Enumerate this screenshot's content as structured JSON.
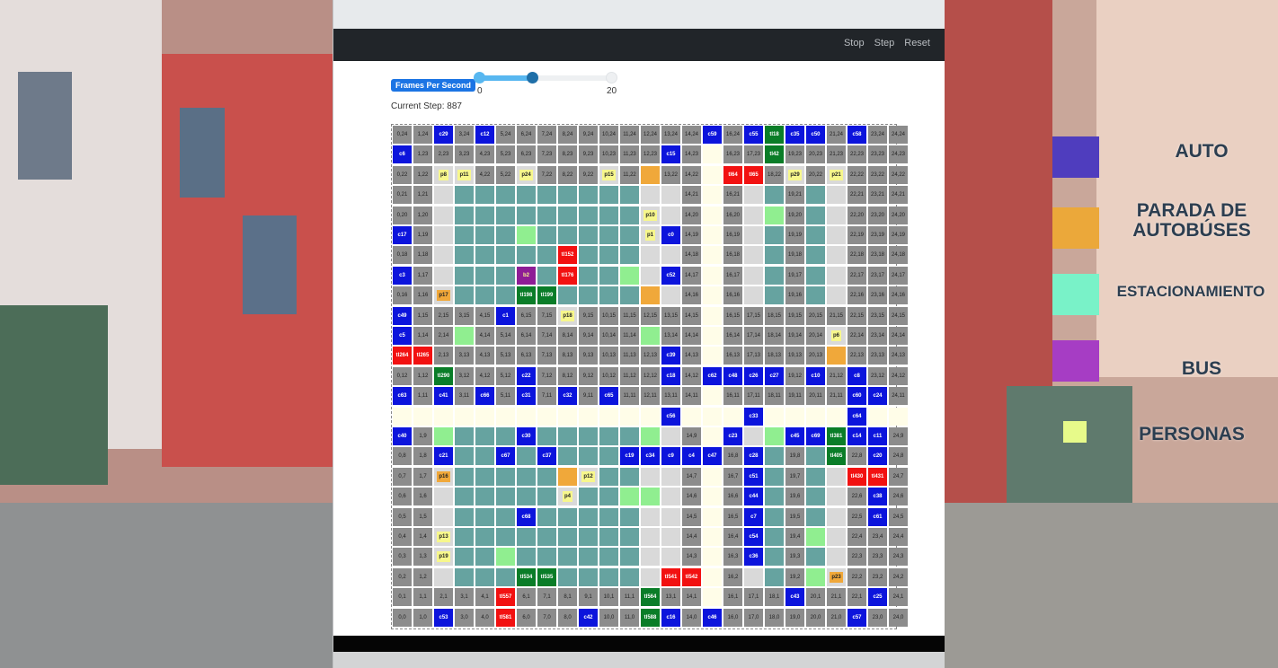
{
  "navbar": {
    "links": [
      "Stop",
      "Step",
      "Reset"
    ]
  },
  "controls": {
    "fps_label": "Frames Per Second",
    "slider": {
      "min": "0",
      "max": "20",
      "value": 8,
      "max_value": 20
    },
    "current_step": "Current Step: 887"
  },
  "colors": {
    "road": "#8c8c8c",
    "parking": "#66a3a0",
    "building": "#d9d9d9",
    "sidewalk": "#fffde8",
    "car": "#0c14dc",
    "light_red": "#f21111",
    "light_green": "#0a7d28",
    "bus_stop": "#f0a83a",
    "person": "#f7f78c",
    "bus": "#8e1d96",
    "grass": "#90ee90"
  },
  "grid": {
    "size": 25,
    "vertical_roads": [
      0,
      1,
      3,
      4,
      5,
      6,
      7,
      8,
      9,
      10,
      11,
      12,
      13,
      14,
      16,
      17,
      19,
      20,
      21,
      22,
      23
    ],
    "horizontal_roads": [
      0,
      1,
      10,
      11,
      12,
      13,
      14,
      15,
      22,
      23,
      24
    ],
    "sidewalk_cols": [
      15
    ],
    "sidewalk_rows": [
      10
    ],
    "block_cols": [
      [
        2,
        13
      ],
      [
        17,
        18
      ],
      [
        20,
        21
      ]
    ],
    "block_rows": [
      [
        2,
        9
      ],
      [
        16,
        21
      ]
    ],
    "grass_cells": [
      [
        6,
        19
      ],
      [
        3,
        14
      ],
      [
        12,
        14
      ],
      [
        12,
        9
      ],
      [
        2,
        9
      ],
      [
        12,
        6
      ],
      [
        18,
        20
      ],
      [
        18,
        9
      ],
      [
        11,
        6
      ],
      [
        21,
        14
      ],
      [
        20,
        4
      ],
      [
        20,
        2
      ],
      [
        5,
        3
      ],
      [
        11,
        17
      ]
    ],
    "tokens": [
      {
        "c": 2,
        "r": 24,
        "t": "c29",
        "k": "car"
      },
      {
        "c": 4,
        "r": 24,
        "t": "c12",
        "k": "car"
      },
      {
        "c": 15,
        "r": 24,
        "t": "c59",
        "k": "car"
      },
      {
        "c": 17,
        "r": 24,
        "t": "c55",
        "k": "car"
      },
      {
        "c": 18,
        "r": 24,
        "t": "tl18",
        "k": "light_green"
      },
      {
        "c": 19,
        "r": 24,
        "t": "c35",
        "k": "car"
      },
      {
        "c": 20,
        "r": 24,
        "t": "c50",
        "k": "car"
      },
      {
        "c": 22,
        "r": 24,
        "t": "c58",
        "k": "car"
      },
      {
        "c": 0,
        "r": 23,
        "t": "c6",
        "k": "car"
      },
      {
        "c": 13,
        "r": 23,
        "t": "c15",
        "k": "car"
      },
      {
        "c": 18,
        "r": 23,
        "t": "tl42",
        "k": "light_green"
      },
      {
        "c": 2,
        "r": 22,
        "t": "p8",
        "k": "person"
      },
      {
        "c": 3,
        "r": 22,
        "t": "p11",
        "k": "person"
      },
      {
        "c": 6,
        "r": 22,
        "t": "p24",
        "k": "person"
      },
      {
        "c": 10,
        "r": 22,
        "t": "p15",
        "k": "person"
      },
      {
        "c": 12,
        "r": 22,
        "t": "",
        "k": "bus_stop"
      },
      {
        "c": 16,
        "r": 22,
        "t": "tl64",
        "k": "light_red"
      },
      {
        "c": 17,
        "r": 22,
        "t": "tl65",
        "k": "light_red"
      },
      {
        "c": 19,
        "r": 22,
        "t": "p29",
        "k": "person"
      },
      {
        "c": 21,
        "r": 22,
        "t": "p21",
        "k": "person"
      },
      {
        "c": 12,
        "r": 20,
        "t": "p10",
        "k": "person"
      },
      {
        "c": 0,
        "r": 19,
        "t": "c17",
        "k": "car"
      },
      {
        "c": 12,
        "r": 19,
        "t": "p1",
        "k": "person"
      },
      {
        "c": 13,
        "r": 19,
        "t": "c0",
        "k": "car"
      },
      {
        "c": 8,
        "r": 18,
        "t": "tl152",
        "k": "light_red"
      },
      {
        "c": 0,
        "r": 17,
        "t": "c3",
        "k": "car"
      },
      {
        "c": 6,
        "r": 17,
        "t": "b2",
        "k": "bus"
      },
      {
        "c": 8,
        "r": 17,
        "t": "tl176",
        "k": "light_red"
      },
      {
        "c": 13,
        "r": 17,
        "t": "c52",
        "k": "car"
      },
      {
        "c": 2,
        "r": 16,
        "t": "p17",
        "k": "bus_stop"
      },
      {
        "c": 6,
        "r": 16,
        "t": "tl198",
        "k": "light_green"
      },
      {
        "c": 7,
        "r": 16,
        "t": "tl199",
        "k": "light_green"
      },
      {
        "c": 12,
        "r": 16,
        "t": "",
        "k": "bus_stop"
      },
      {
        "c": 0,
        "r": 15,
        "t": "c49",
        "k": "car"
      },
      {
        "c": 5,
        "r": 15,
        "t": "c1",
        "k": "car"
      },
      {
        "c": 8,
        "r": 15,
        "t": "p18",
        "k": "person"
      },
      {
        "c": 0,
        "r": 14,
        "t": "c5",
        "k": "car"
      },
      {
        "c": 21,
        "r": 14,
        "t": "p6",
        "k": "person"
      },
      {
        "c": 0,
        "r": 13,
        "t": "tl264",
        "k": "light_red"
      },
      {
        "c": 1,
        "r": 13,
        "t": "tl265",
        "k": "light_red"
      },
      {
        "c": 13,
        "r": 13,
        "t": "c39",
        "k": "car"
      },
      {
        "c": 21,
        "r": 13,
        "t": "",
        "k": "bus_stop"
      },
      {
        "c": 2,
        "r": 12,
        "t": "tl290",
        "k": "light_green"
      },
      {
        "c": 6,
        "r": 12,
        "t": "c22",
        "k": "car"
      },
      {
        "c": 13,
        "r": 12,
        "t": "c18",
        "k": "car"
      },
      {
        "c": 15,
        "r": 12,
        "t": "c62",
        "k": "car"
      },
      {
        "c": 16,
        "r": 12,
        "t": "c48",
        "k": "car"
      },
      {
        "c": 17,
        "r": 12,
        "t": "c26",
        "k": "car"
      },
      {
        "c": 18,
        "r": 12,
        "t": "c27",
        "k": "car"
      },
      {
        "c": 20,
        "r": 12,
        "t": "c10",
        "k": "car"
      },
      {
        "c": 22,
        "r": 12,
        "t": "c8",
        "k": "car"
      },
      {
        "c": 0,
        "r": 11,
        "t": "c63",
        "k": "car"
      },
      {
        "c": 2,
        "r": 11,
        "t": "c41",
        "k": "car"
      },
      {
        "c": 4,
        "r": 11,
        "t": "c66",
        "k": "car"
      },
      {
        "c": 6,
        "r": 11,
        "t": "c31",
        "k": "car"
      },
      {
        "c": 8,
        "r": 11,
        "t": "c32",
        "k": "car"
      },
      {
        "c": 10,
        "r": 11,
        "t": "c65",
        "k": "car"
      },
      {
        "c": 22,
        "r": 11,
        "t": "c60",
        "k": "car"
      },
      {
        "c": 23,
        "r": 11,
        "t": "c24",
        "k": "car"
      },
      {
        "c": 13,
        "r": 10,
        "t": "c56",
        "k": "car"
      },
      {
        "c": 17,
        "r": 10,
        "t": "c33",
        "k": "car"
      },
      {
        "c": 22,
        "r": 10,
        "t": "c64",
        "k": "car"
      },
      {
        "c": 0,
        "r": 9,
        "t": "c40",
        "k": "car"
      },
      {
        "c": 6,
        "r": 9,
        "t": "c30",
        "k": "car"
      },
      {
        "c": 16,
        "r": 9,
        "t": "c23",
        "k": "car"
      },
      {
        "c": 19,
        "r": 9,
        "t": "c45",
        "k": "car"
      },
      {
        "c": 20,
        "r": 9,
        "t": "c69",
        "k": "car"
      },
      {
        "c": 21,
        "r": 9,
        "t": "tl381",
        "k": "light_green"
      },
      {
        "c": 22,
        "r": 9,
        "t": "c14",
        "k": "car"
      },
      {
        "c": 23,
        "r": 9,
        "t": "c11",
        "k": "car"
      },
      {
        "c": 2,
        "r": 8,
        "t": "c21",
        "k": "car"
      },
      {
        "c": 5,
        "r": 8,
        "t": "c67",
        "k": "car"
      },
      {
        "c": 7,
        "r": 8,
        "t": "c37",
        "k": "car"
      },
      {
        "c": 11,
        "r": 8,
        "t": "c19",
        "k": "car"
      },
      {
        "c": 12,
        "r": 8,
        "t": "c34",
        "k": "car"
      },
      {
        "c": 13,
        "r": 8,
        "t": "c9",
        "k": "car"
      },
      {
        "c": 14,
        "r": 8,
        "t": "c4",
        "k": "car"
      },
      {
        "c": 15,
        "r": 8,
        "t": "c47",
        "k": "car"
      },
      {
        "c": 17,
        "r": 8,
        "t": "c28",
        "k": "car"
      },
      {
        "c": 21,
        "r": 8,
        "t": "tl405",
        "k": "light_green"
      },
      {
        "c": 23,
        "r": 8,
        "t": "c20",
        "k": "car"
      },
      {
        "c": 2,
        "r": 7,
        "t": "p16",
        "k": "bus_stop"
      },
      {
        "c": 8,
        "r": 7,
        "t": "",
        "k": "bus_stop"
      },
      {
        "c": 9,
        "r": 7,
        "t": "p12",
        "k": "person"
      },
      {
        "c": 17,
        "r": 7,
        "t": "c51",
        "k": "car"
      },
      {
        "c": 22,
        "r": 7,
        "t": "tl430",
        "k": "light_red"
      },
      {
        "c": 23,
        "r": 7,
        "t": "tl431",
        "k": "light_red"
      },
      {
        "c": 8,
        "r": 6,
        "t": "p4",
        "k": "person"
      },
      {
        "c": 17,
        "r": 6,
        "t": "c44",
        "k": "car"
      },
      {
        "c": 23,
        "r": 6,
        "t": "c38",
        "k": "car"
      },
      {
        "c": 6,
        "r": 5,
        "t": "c68",
        "k": "car"
      },
      {
        "c": 17,
        "r": 5,
        "t": "c7",
        "k": "car"
      },
      {
        "c": 23,
        "r": 5,
        "t": "c61",
        "k": "car"
      },
      {
        "c": 2,
        "r": 4,
        "t": "p13",
        "k": "person"
      },
      {
        "c": 17,
        "r": 4,
        "t": "c54",
        "k": "car"
      },
      {
        "c": 2,
        "r": 3,
        "t": "p19",
        "k": "person"
      },
      {
        "c": 17,
        "r": 3,
        "t": "c36",
        "k": "car"
      },
      {
        "c": 6,
        "r": 2,
        "t": "tl534",
        "k": "light_green"
      },
      {
        "c": 7,
        "r": 2,
        "t": "tl535",
        "k": "light_green"
      },
      {
        "c": 13,
        "r": 2,
        "t": "tl541",
        "k": "light_red"
      },
      {
        "c": 14,
        "r": 2,
        "t": "tl542",
        "k": "light_red"
      },
      {
        "c": 21,
        "r": 2,
        "t": "p23",
        "k": "bus_stop"
      },
      {
        "c": 5,
        "r": 1,
        "t": "tl557",
        "k": "light_red"
      },
      {
        "c": 12,
        "r": 1,
        "t": "tl564",
        "k": "light_green"
      },
      {
        "c": 19,
        "r": 1,
        "t": "c43",
        "k": "car"
      },
      {
        "c": 23,
        "r": 1,
        "t": "c25",
        "k": "car"
      },
      {
        "c": 2,
        "r": 0,
        "t": "c53",
        "k": "car"
      },
      {
        "c": 5,
        "r": 0,
        "t": "tl581",
        "k": "light_red"
      },
      {
        "c": 9,
        "r": 0,
        "t": "c42",
        "k": "car"
      },
      {
        "c": 12,
        "r": 0,
        "t": "tl588",
        "k": "light_green"
      },
      {
        "c": 13,
        "r": 0,
        "t": "c16",
        "k": "car"
      },
      {
        "c": 15,
        "r": 0,
        "t": "c46",
        "k": "car"
      },
      {
        "c": 22,
        "r": 0,
        "t": "c57",
        "k": "car"
      }
    ]
  },
  "legend": [
    {
      "label": "AUTO",
      "color": "#4f3dbe"
    },
    {
      "label": "PARADA DE AUTOBÚSES",
      "color": "#eba83a"
    },
    {
      "label": "ESTACIONAMIENTO",
      "color": "#79f2c8"
    },
    {
      "label": "BUS",
      "color": "#a63dc4"
    },
    {
      "label": "PERSONAS",
      "color": "#e7fa8a"
    }
  ]
}
